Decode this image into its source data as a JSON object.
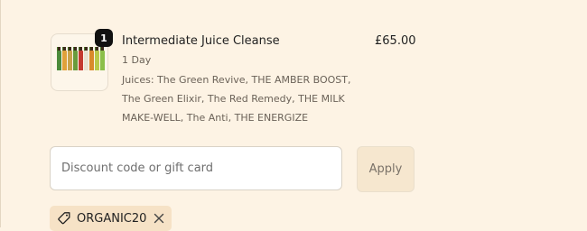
{
  "line_item": {
    "quantity": "1",
    "title": "Intermediate Juice Cleanse",
    "price": "£65.00",
    "variant": "1 Day",
    "description": "Juices: The Green Revive, THE AMBER BOOST, The Green Elixir, The Red Remedy, THE MILK MAKE-WELL, The Anti, THE ENERGIZE",
    "bottle_colors": [
      "#4b8b3b",
      "#e0a13a",
      "#c9a24a",
      "#6a9b3c",
      "#c43a2f",
      "#e8e2d0",
      "#d98a2b",
      "#b8c94a",
      "#8bbf4a"
    ]
  },
  "discount": {
    "placeholder": "Discount code or gift card",
    "value": "",
    "apply_label": "Apply"
  },
  "applied_code": {
    "code": "ORGANIC20",
    "icon": "tag-icon",
    "remove_icon": "close-icon"
  }
}
